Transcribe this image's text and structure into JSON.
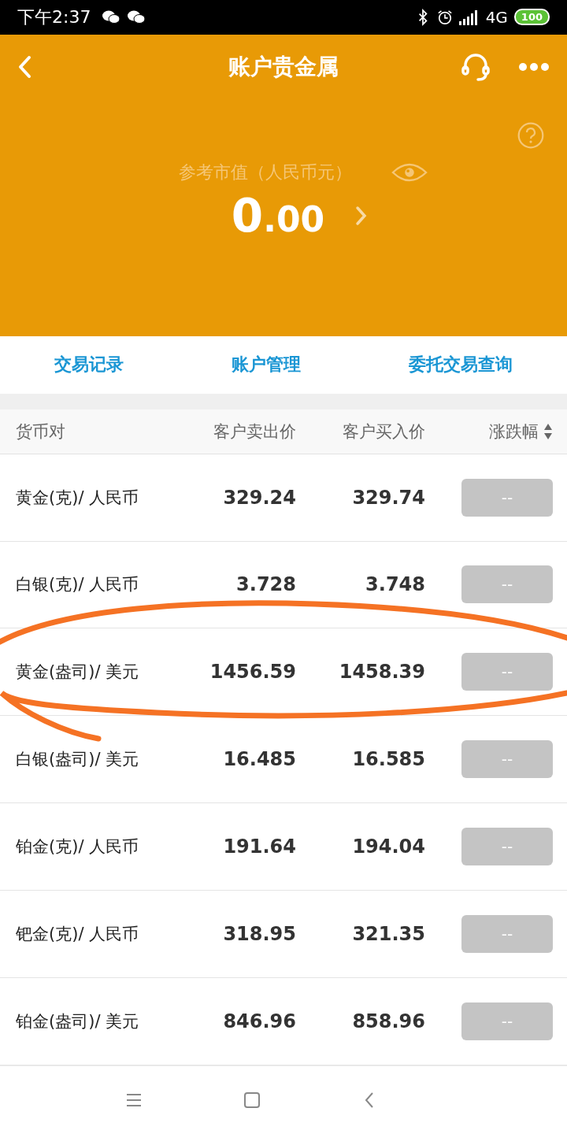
{
  "status_bar": {
    "time": "下午2:37",
    "network": "4G",
    "battery": "100"
  },
  "header": {
    "title": "账户贵金属",
    "balance_label": "参考市值（人民币元）",
    "balance_integer": "0",
    "balance_decimal": ".00"
  },
  "tabs": [
    {
      "label": "交易记录"
    },
    {
      "label": "账户管理"
    },
    {
      "label": "委托交易查询"
    }
  ],
  "table": {
    "columns": [
      "货币对",
      "客户卖出价",
      "客户买入价",
      "涨跌幅"
    ],
    "rows": [
      {
        "pair": "黄金(克)/ 人民币",
        "sell": "329.24",
        "buy": "329.74",
        "change": "--"
      },
      {
        "pair": "白银(克)/ 人民币",
        "sell": "3.728",
        "buy": "3.748",
        "change": "--"
      },
      {
        "pair": "黄金(盎司)/ 美元",
        "sell": "1456.59",
        "buy": "1458.39",
        "change": "--"
      },
      {
        "pair": "白银(盎司)/ 美元",
        "sell": "16.485",
        "buy": "16.585",
        "change": "--"
      },
      {
        "pair": "铂金(克)/ 人民币",
        "sell": "191.64",
        "buy": "194.04",
        "change": "--"
      },
      {
        "pair": "钯金(克)/ 人民币",
        "sell": "318.95",
        "buy": "321.35",
        "change": "--"
      },
      {
        "pair": "铂金(盎司)/ 美元",
        "sell": "846.96",
        "buy": "858.96",
        "change": "--"
      }
    ]
  }
}
